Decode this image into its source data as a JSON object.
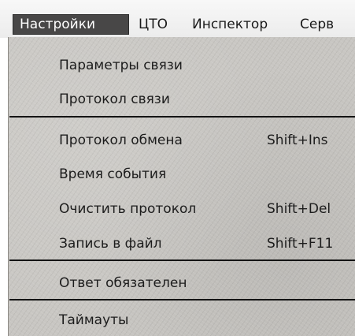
{
  "menubar": {
    "items": [
      {
        "label": "Настройки"
      },
      {
        "label": "ЦТО"
      },
      {
        "label": "Инспектор"
      },
      {
        "label": "Серв"
      }
    ]
  },
  "dropdown": {
    "items": [
      {
        "label": "Параметры связи",
        "shortcut": ""
      },
      {
        "label": "Протокол связи",
        "shortcut": ""
      },
      {
        "label": "Протокол обмена",
        "shortcut": "Shift+Ins"
      },
      {
        "label": "Время события",
        "shortcut": ""
      },
      {
        "label": "Очистить протокол",
        "shortcut": "Shift+Del"
      },
      {
        "label": "Запись в файл",
        "shortcut": "Shift+F11"
      },
      {
        "label": "Ответ обязателен",
        "shortcut": ""
      },
      {
        "label": "Таймауты",
        "shortcut": ""
      }
    ]
  }
}
